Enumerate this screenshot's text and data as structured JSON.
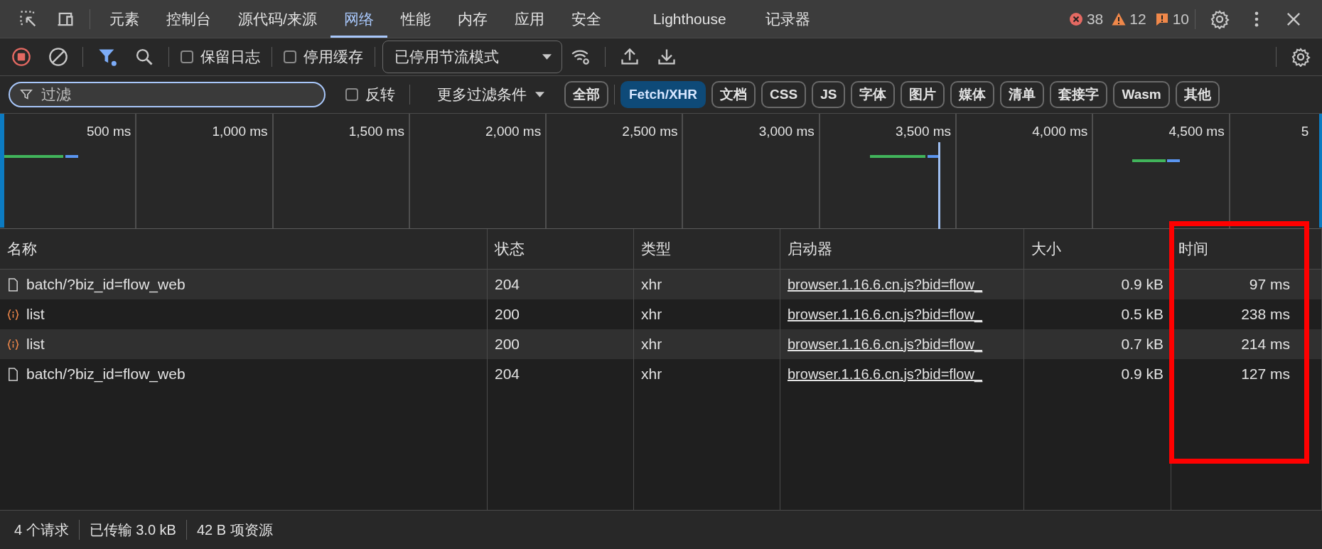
{
  "tabs": [
    {
      "label": "元素",
      "selected": false
    },
    {
      "label": "控制台",
      "selected": false
    },
    {
      "label": "源代码/来源",
      "selected": false
    },
    {
      "label": "网络",
      "selected": true
    },
    {
      "label": "性能",
      "selected": false
    },
    {
      "label": "内存",
      "selected": false
    },
    {
      "label": "应用",
      "selected": false
    },
    {
      "label": "安全",
      "selected": false
    },
    {
      "label": "Lighthouse",
      "selected": false
    },
    {
      "label": "记录器",
      "selected": false
    }
  ],
  "issues": [
    {
      "kind": "error",
      "count": "38"
    },
    {
      "kind": "warning",
      "count": "12"
    },
    {
      "kind": "info",
      "count": "10"
    }
  ],
  "toolbar": {
    "recording": true,
    "checkboxes": [
      {
        "label": "保留日志",
        "checked": false
      },
      {
        "label": "停用缓存",
        "checked": false
      }
    ],
    "throttling": "已停用节流模式"
  },
  "filter": {
    "placeholder": "过滤",
    "invert": {
      "label": "反转",
      "checked": false
    },
    "more_filters": "更多过滤条件",
    "types": [
      {
        "label": "全部",
        "selected": false
      },
      {
        "label": "Fetch/XHR",
        "selected": true
      },
      {
        "label": "文档",
        "selected": false
      },
      {
        "label": "CSS",
        "selected": false
      },
      {
        "label": "JS",
        "selected": false
      },
      {
        "label": "字体",
        "selected": false
      },
      {
        "label": "图片",
        "selected": false
      },
      {
        "label": "媒体",
        "selected": false
      },
      {
        "label": "清单",
        "selected": false
      },
      {
        "label": "套接字",
        "selected": false
      },
      {
        "label": "Wasm",
        "selected": false
      },
      {
        "label": "其他",
        "selected": false
      }
    ]
  },
  "timeline": {
    "ticks": [
      "500 ms",
      "1,000 ms",
      "1,500 ms",
      "2,000 ms",
      "2,500 ms",
      "3,000 ms",
      "3,500 ms",
      "4,000 ms",
      "4,500 ms",
      "5"
    ]
  },
  "table": {
    "columns": [
      "名称",
      "状态",
      "类型",
      "启动器",
      "大小",
      "时间"
    ],
    "rows": [
      {
        "kind": "document",
        "name": "batch/?biz_id=flow_web",
        "status": "204",
        "type": "xhr",
        "initiator": "browser.1.16.6.cn.js?bid=flow_",
        "size": "0.9 kB",
        "time": "97 ms"
      },
      {
        "kind": "fetch",
        "name": "list",
        "status": "200",
        "type": "xhr",
        "initiator": "browser.1.16.6.cn.js?bid=flow_",
        "size": "0.5 kB",
        "time": "238 ms"
      },
      {
        "kind": "fetch",
        "name": "list",
        "status": "200",
        "type": "xhr",
        "initiator": "browser.1.16.6.cn.js?bid=flow_",
        "size": "0.7 kB",
        "time": "214 ms"
      },
      {
        "kind": "document",
        "name": "batch/?biz_id=flow_web",
        "status": "204",
        "type": "xhr",
        "initiator": "browser.1.16.6.cn.js?bid=flow_",
        "size": "0.9 kB",
        "time": "127 ms"
      }
    ]
  },
  "status_bar": [
    "4 个请求",
    "已传输 3.0 kB",
    "42 B 项资源"
  ]
}
